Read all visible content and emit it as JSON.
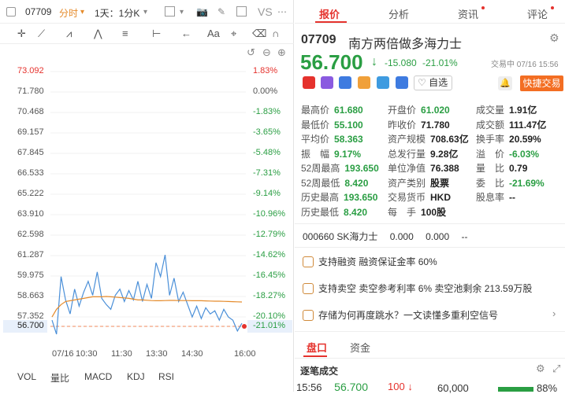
{
  "left_toolbar": {
    "code": "07709",
    "mode": "分时",
    "period": "1天：1分K",
    "vs": "VS"
  },
  "chart_data": {
    "type": "line",
    "title": "",
    "x_ticks": [
      "07/16",
      "10:30",
      "11:30",
      "13:30",
      "14:30",
      "16:00"
    ],
    "y_left_ticks": [
      "73.092",
      "71.780",
      "70.468",
      "69.157",
      "67.845",
      "66.533",
      "65.222",
      "63.910",
      "62.598",
      "61.287",
      "59.975",
      "58.663",
      "57.352",
      "56.700"
    ],
    "y_right_ticks": [
      "1.83%",
      "0.00%",
      "-1.83%",
      "-3.65%",
      "-5.48%",
      "-7.31%",
      "-9.14%",
      "-10.96%",
      "-12.79%",
      "-14.62%",
      "-16.45%",
      "-18.27%",
      "-20.10%",
      "-21.01%"
    ],
    "series": [
      {
        "values": [
          57.1,
          56.2,
          59.9,
          58.4,
          57.5,
          59.1,
          58.0,
          58.9,
          59.6,
          58.7,
          60.2,
          58.5,
          58.1,
          57.8,
          58.7,
          59.1,
          58.3,
          59.0,
          58.4,
          59.6,
          58.3,
          59.4,
          58.5,
          60.8,
          59.9,
          61.3,
          58.7,
          59.8,
          58.3,
          58.9,
          58.1,
          57.3,
          58.0,
          57.2,
          57.9,
          57.5,
          57.7,
          57.1,
          57.8,
          57.3,
          57.1,
          56.4,
          56.9
        ]
      },
      {
        "values": [
          57.3,
          57.8,
          58.1,
          58.3,
          58.35,
          58.4,
          58.45,
          58.5,
          58.55,
          58.6,
          58.6,
          58.6,
          58.62,
          58.6,
          58.58,
          58.55,
          58.53,
          58.5,
          58.45,
          58.4,
          58.4,
          58.38,
          58.36,
          58.35,
          58.35,
          58.36,
          58.37,
          58.37,
          58.36,
          58.36,
          58.36,
          58.35,
          58.35,
          58.35,
          58.34,
          58.33,
          58.32,
          58.32,
          58.31,
          58.3,
          58.29,
          58.28,
          58.27
        ]
      }
    ],
    "prev_close": 71.78,
    "current": 56.7,
    "ylim": [
      56.7,
      73.092
    ]
  },
  "bottom_tabs": [
    "VOL",
    "量比",
    "MACD",
    "KDJ",
    "RSI"
  ],
  "right_tabs": [
    "报价",
    "分析",
    "资讯",
    "评论"
  ],
  "quote": {
    "code": "07709",
    "name": "南方两倍做多海力士",
    "price": "56.700",
    "arrow": "↓",
    "change": "-15.080",
    "pct": "-21.01%",
    "trade_time": "交易中 07/16 15:56",
    "watch_label": "自选",
    "quick_trade": "快捷交易"
  },
  "stats": {
    "c1": [
      [
        "最高价",
        "61.680"
      ],
      [
        "最低价",
        "55.100"
      ],
      [
        "平均价",
        "58.363"
      ],
      [
        "振　幅",
        "9.17%"
      ],
      [
        "52周最高",
        "193.650"
      ],
      [
        "52周最低",
        "8.420"
      ],
      [
        "历史最高",
        "193.650"
      ],
      [
        "历史最低",
        "8.420"
      ]
    ],
    "c2": [
      [
        "开盘价",
        "61.020"
      ],
      [
        "昨收价",
        "71.780"
      ],
      [
        "资产规模",
        "708.63亿"
      ],
      [
        "总发行量",
        "9.28亿"
      ],
      [
        "单位净值",
        "76.388"
      ],
      [
        "资产类别",
        "股票"
      ],
      [
        "交易货币",
        "HKD"
      ],
      [
        "每　手",
        "100股"
      ]
    ],
    "c3": [
      [
        "成交量",
        "1.91亿"
      ],
      [
        "成交额",
        "111.47亿"
      ],
      [
        "换手率",
        "20.59%"
      ],
      [
        "溢　价",
        "-6.03%"
      ],
      [
        "量　比",
        "0.79"
      ],
      [
        "委　比",
        "-21.69%"
      ],
      [
        "股息率",
        "--"
      ]
    ]
  },
  "underlying": {
    "code": "000660",
    "name": "SK海力士",
    "v1": "0.000",
    "v2": "0.000",
    "v3": "--"
  },
  "info_rows": [
    {
      "a": "支持融资",
      "b": "融资保证金率 60%"
    },
    {
      "a": "支持卖空",
      "b": "卖空参考利率 6%  卖空池剩余 213.59万股"
    },
    {
      "a": "存储为何再度跳水？一文读懂多重利空信号",
      "b": ""
    }
  ],
  "sub_tabs": [
    "盘口",
    "资金"
  ],
  "ticks_title": "逐笔成交",
  "last_tick": {
    "time": "15:56",
    "price": "56.700",
    "qty": "100",
    "arrow": "↓",
    "vol": "60,000",
    "pct": "88%"
  }
}
